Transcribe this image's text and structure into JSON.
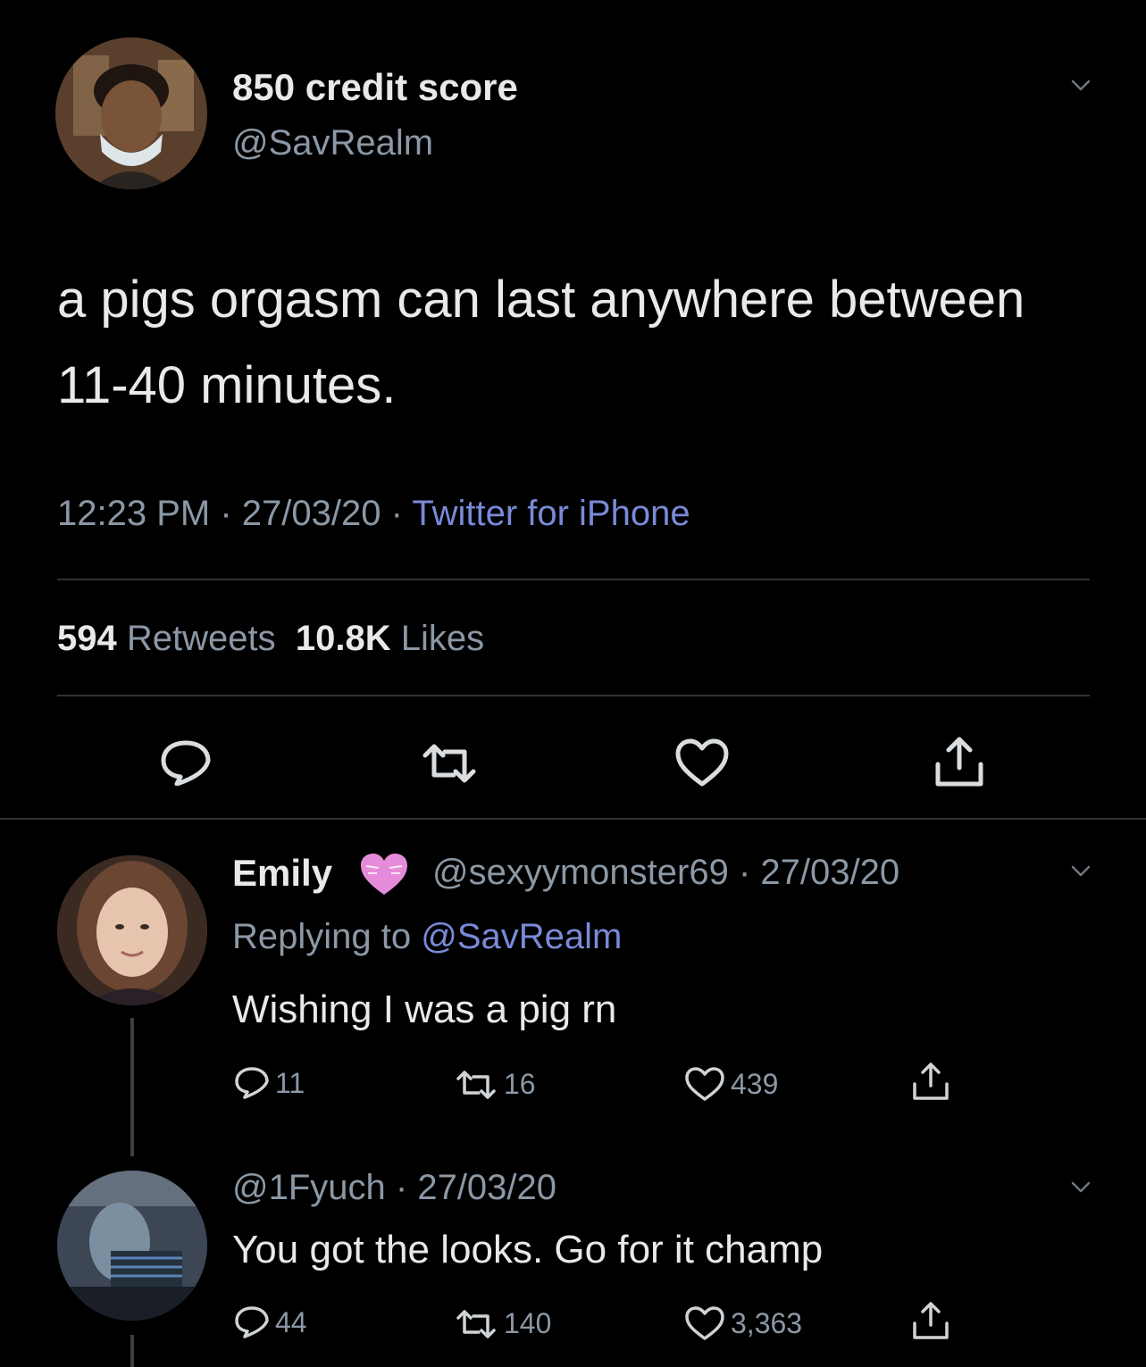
{
  "main_tweet": {
    "display_name": "850 credit score",
    "handle": "@SavRealm",
    "text": "a pigs orgasm can last anywhere between 11-40 minutes.",
    "time": "12:23 PM",
    "date": "27/03/20",
    "separator": "·",
    "source": "Twitter for iPhone",
    "retweets_count": "594",
    "retweets_label": "Retweets",
    "likes_count": "10.8K",
    "likes_label": "Likes"
  },
  "replies": [
    {
      "display_name": "Emily",
      "badge_icon": "pink-heart-emoji",
      "handle_date": "@sexyymonster69 · 27/03/20",
      "replying_label": "Replying to",
      "replying_mention": "@SavRealm",
      "text": "Wishing I was a pig rn",
      "reply_count": "11",
      "retweet_count": "16",
      "like_count": "439"
    },
    {
      "handle_date": "@1Fyuch · 27/03/20",
      "text": "You got the looks. Go for it champ",
      "reply_count": "44",
      "retweet_count": "140",
      "like_count": "3,363"
    }
  ],
  "colors": {
    "background": "#000000",
    "text": "#e7e9ea",
    "muted": "#8b98a5",
    "link": "#7a8ad8",
    "divider": "#2f3336",
    "heart_badge": "#e58bd9"
  }
}
